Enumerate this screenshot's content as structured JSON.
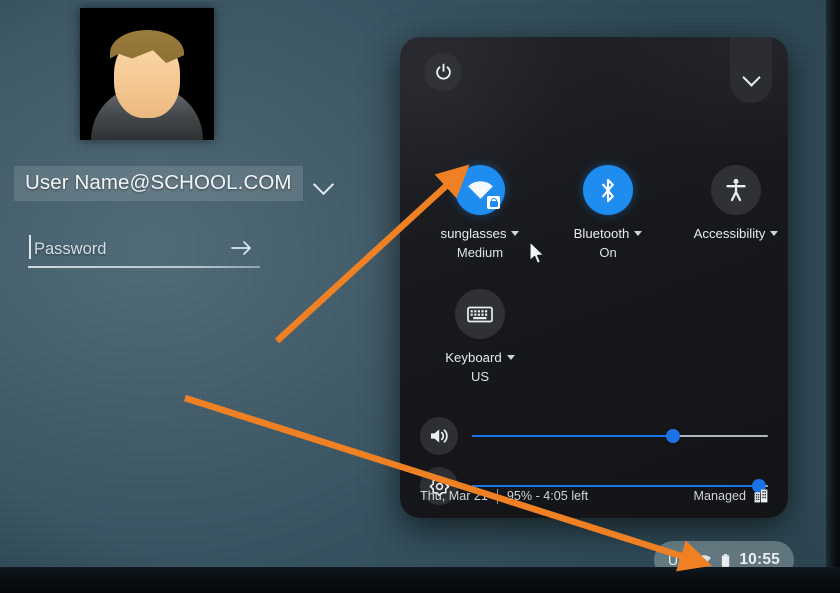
{
  "login": {
    "avatar_alt": "user-avatar-placeholder",
    "account_name": "User Name@SCHOOL.COM",
    "account_chevron_icon": "chevron-down-icon",
    "password_placeholder": "Password",
    "password_value": "",
    "password_submit_icon": "arrow-right-icon"
  },
  "quick_settings": {
    "power_icon": "power-icon",
    "collapse_icon": "chevron-down-icon",
    "pods": [
      {
        "id": "network",
        "icon": "wifi-locked-icon",
        "label": "sunglasses",
        "sub": "Medium",
        "state": "on",
        "has_caret": true
      },
      {
        "id": "bluetooth",
        "icon": "bluetooth-icon",
        "label": "Bluetooth",
        "sub": "On",
        "state": "on",
        "has_caret": true
      },
      {
        "id": "accessibility",
        "icon": "accessibility-icon",
        "label": "Accessibility",
        "sub": "",
        "state": "off",
        "has_caret": true
      },
      {
        "id": "keyboard",
        "icon": "keyboard-icon",
        "label": "Keyboard",
        "sub": "US",
        "state": "off",
        "has_caret": true
      }
    ],
    "sliders": [
      {
        "id": "volume",
        "icon": "volume-icon",
        "value": 68
      },
      {
        "id": "brightness",
        "icon": "brightness-icon",
        "value": 97
      }
    ],
    "footer": {
      "date": "Thu, Mar 21",
      "battery": "95% - 4:05 left",
      "managed_label": "Managed",
      "managed_icon": "enterprise-building-icon"
    }
  },
  "tray": {
    "locale": "US",
    "wifi_icon": "wifi-icon",
    "battery_icon": "battery-full-icon",
    "time": "10:55"
  },
  "colors": {
    "accent_blue": "#1f8cf0",
    "slider_blue": "#1a73e8",
    "panel_bg": "#1b1d21",
    "annotation_orange": "#ef8024"
  },
  "annotations": [
    {
      "id": "arrow-to-wifi-pod",
      "color": "#ef8024",
      "target": "network-pod-icon"
    },
    {
      "id": "arrow-to-tray-wifi",
      "color": "#ef8024",
      "target": "tray-wifi-icon"
    }
  ]
}
